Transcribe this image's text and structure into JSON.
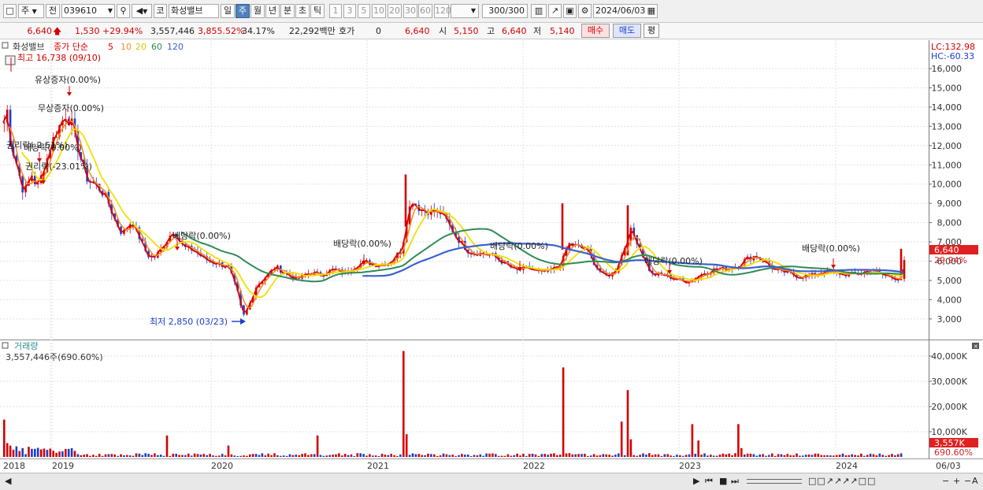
{
  "toolbar": {
    "mode_label": "주",
    "prev_label": "전",
    "code": "039610",
    "type_label": "코",
    "stock_name": "화성밸브",
    "periods": [
      "일",
      "주",
      "월",
      "년",
      "분",
      "초",
      "틱"
    ],
    "selected_period": "주",
    "intervals": [
      "1",
      "3",
      "5",
      "10",
      "20",
      "30",
      "60",
      "120"
    ],
    "count": "300",
    "count_total": "/300",
    "date": "2024/06/03"
  },
  "quote": {
    "price": "6,640",
    "change": "1,530",
    "change_pct": "+29.94%",
    "volume": "3,557,446",
    "volume_ratio": "3,855.52%",
    "turnover_pct": "34.17%",
    "amount": "22,292백만",
    "hoga_label": "호가",
    "hoga_value": "0",
    "hoga_price": "6,640",
    "open_label": "시",
    "open": "5,150",
    "high_label": "고",
    "high": "6,640",
    "low_label": "저",
    "low": "5,140",
    "buy_label": "매수",
    "sell_label": "매도",
    "eval_label": "평"
  },
  "price_panel": {
    "name": "화성밸브",
    "ma_title": "종가 단순",
    "ma_periods": [
      "5",
      "10",
      "20",
      "60",
      "120"
    ],
    "lc_label": "LC:132.98",
    "hc_label": "HC:-60.33",
    "y_ticks": [
      "16,000",
      "15,000",
      "14,000",
      "13,000",
      "12,000",
      "11,000",
      "10,000",
      "9,000",
      "8,000",
      "7,000",
      "6,000",
      "5,000",
      "4,000",
      "3,000"
    ],
    "last_price": "6,640",
    "last_pct": "29.94%",
    "high_note": "최고 16,738 (09/10)",
    "low_note": "최저 2,850 (03/23)",
    "events": [
      "유상증자(0.00%)",
      "무상증자(0.00%)",
      "권리락(-2.51%)",
      "배당락(0.00%)",
      "권리락(-23.01%)",
      "배당락(0.00%)",
      "배당락(0.00%)",
      "배당락(0.00%)",
      "배당락(0.00%)",
      "배당락(0.00%)"
    ]
  },
  "volume_panel": {
    "title": "거래량",
    "summary": "3,557,446주(690.60%)",
    "y_ticks": [
      "40,000K",
      "30,000K",
      "20,000K",
      "10,000K"
    ],
    "last_volume": "3,557K",
    "last_pct": "690.60%"
  },
  "x_axis": [
    "2018",
    "2019",
    "2020",
    "2021",
    "2022",
    "2023",
    "2024",
    "06/03"
  ],
  "colors": {
    "up": "#d40000",
    "down": "#1a3dd0",
    "ma5": "#e00000",
    "ma10": "#f28c28",
    "ma20": "#f0e000",
    "ma60": "#2e8b57",
    "ma120": "#3a5fcd"
  }
}
